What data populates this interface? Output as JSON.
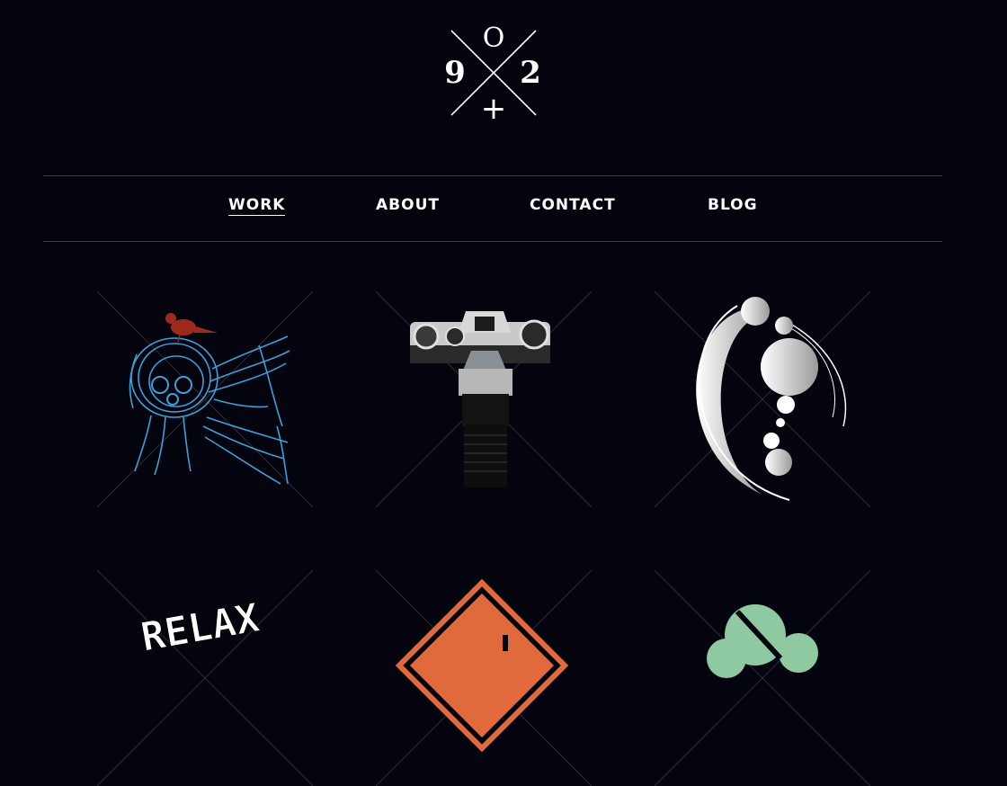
{
  "logo": {
    "top": "O",
    "left": "9",
    "right": "2",
    "bottom": "+"
  },
  "nav": {
    "items": [
      {
        "label": "WORK",
        "active": true
      },
      {
        "label": "ABOUT",
        "active": false
      },
      {
        "label": "CONTACT",
        "active": false
      },
      {
        "label": "BLOG",
        "active": false
      }
    ]
  },
  "portfolio": {
    "tiles": [
      {
        "icon": "bird-nest-creature-illustration"
      },
      {
        "icon": "camera-with-zoom-lens-photo"
      },
      {
        "icon": "white-moon-circles-illustration"
      },
      {
        "icon": "relax-pixel-lettering",
        "text": "RELAX"
      },
      {
        "icon": "orange-warning-sign"
      },
      {
        "icon": "green-abstract-shape"
      }
    ]
  },
  "colors": {
    "background": "#04040e",
    "rule": "#3a3738",
    "nav_text": "#ffffff",
    "tile_cross": "#2f2d30",
    "creature_blue": "#3c9fd8",
    "bird_red": "#a0291d",
    "sign_orange": "#e06a3c",
    "shape_green": "#8fc9a1"
  }
}
